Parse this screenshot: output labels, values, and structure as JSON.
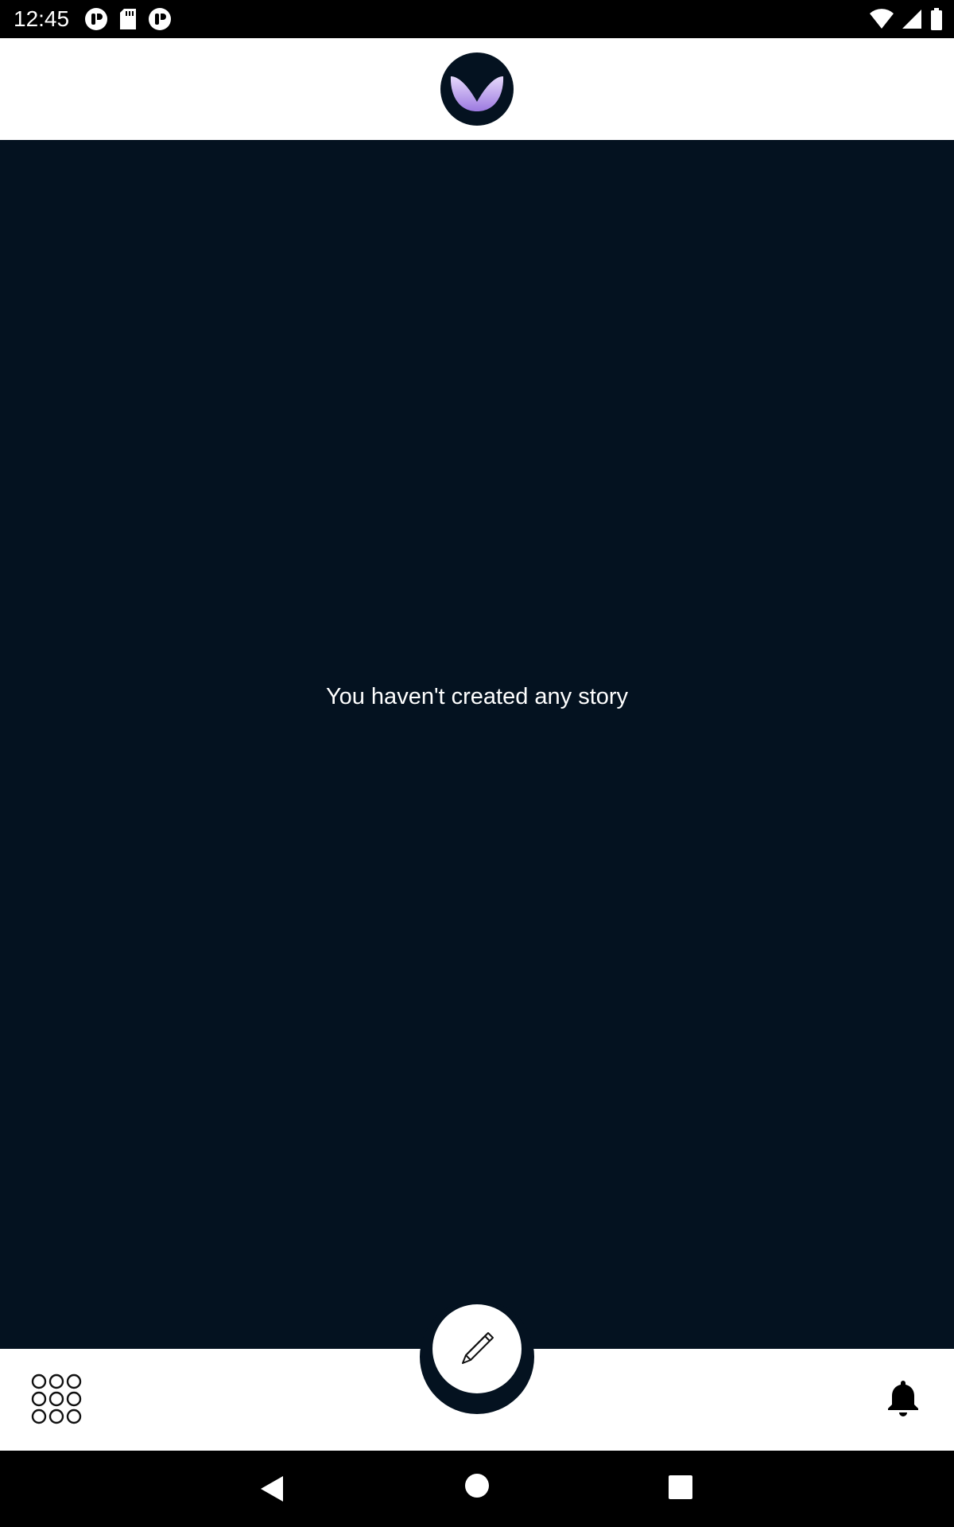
{
  "status_bar": {
    "time": "12:45",
    "notification_icons": [
      "app-notification-icon",
      "sd-card-icon",
      "app-notification-icon"
    ],
    "system_icons": [
      "wifi-icon",
      "cellular-signal-icon",
      "battery-icon"
    ]
  },
  "header": {
    "logo": "app-logo-icon"
  },
  "main": {
    "empty_message": "You haven't created any story"
  },
  "bottom_bar": {
    "left_icon": "grid-menu-icon",
    "center_icon": "pencil-icon",
    "right_icon": "bell-icon"
  },
  "nav_bar": {
    "buttons": [
      "back-icon",
      "home-icon",
      "recents-icon"
    ]
  },
  "colors": {
    "content_background": "#041220",
    "header_background": "#ffffff",
    "logo_accent": "#c3a6f0",
    "text": "#ffffff"
  }
}
